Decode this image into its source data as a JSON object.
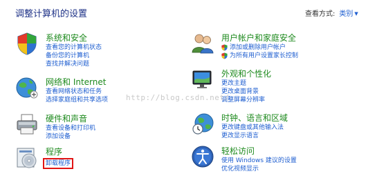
{
  "page": {
    "title": "调整计算机的设置",
    "view_by_label": "查看方式:",
    "view_by_value": "类别"
  },
  "categories": [
    {
      "id": "system-security",
      "icon": "shield-icon",
      "title": "系统和安全",
      "links": [
        "查看您的计算机状态",
        "备份您的计算机",
        "查找并解决问题"
      ]
    },
    {
      "id": "network-internet",
      "icon": "globe-network-icon",
      "title": "网络和 Internet",
      "links": [
        "查看网络状态和任务",
        "选择家庭组和共享选项"
      ]
    },
    {
      "id": "hardware-sound",
      "icon": "printer-icon",
      "title": "硬件和声音",
      "links": [
        "查看设备和打印机",
        "添加设备"
      ]
    },
    {
      "id": "programs",
      "icon": "programs-disc-icon",
      "title": "程序",
      "links": [
        "卸载程序"
      ]
    },
    {
      "id": "user-accounts",
      "icon": "users-icon",
      "title": "用户帐户和家庭安全",
      "links": [
        "添加或删除用户帐户",
        "为所有用户设置家长控制"
      ]
    },
    {
      "id": "appearance",
      "icon": "monitor-icon",
      "title": "外观和个性化",
      "links": [
        "更改主题",
        "更改桌面背景",
        "调整屏幕分辨率"
      ]
    },
    {
      "id": "clock-language-region",
      "icon": "clock-globe-icon",
      "title": "时钟、语言和区域",
      "links": [
        "更改键盘或其他输入法",
        "更改显示语言"
      ]
    },
    {
      "id": "ease-of-access",
      "icon": "accessibility-icon",
      "title": "轻松访问",
      "links": [
        "使用 Windows 建议的设置",
        "优化视频显示"
      ]
    }
  ],
  "watermark": "http://blog.csdn.net/",
  "colors": {
    "category_title": "#1e8a1e",
    "link": "#1e5ed0",
    "header": "#1e3287",
    "highlight": "#e11414"
  }
}
